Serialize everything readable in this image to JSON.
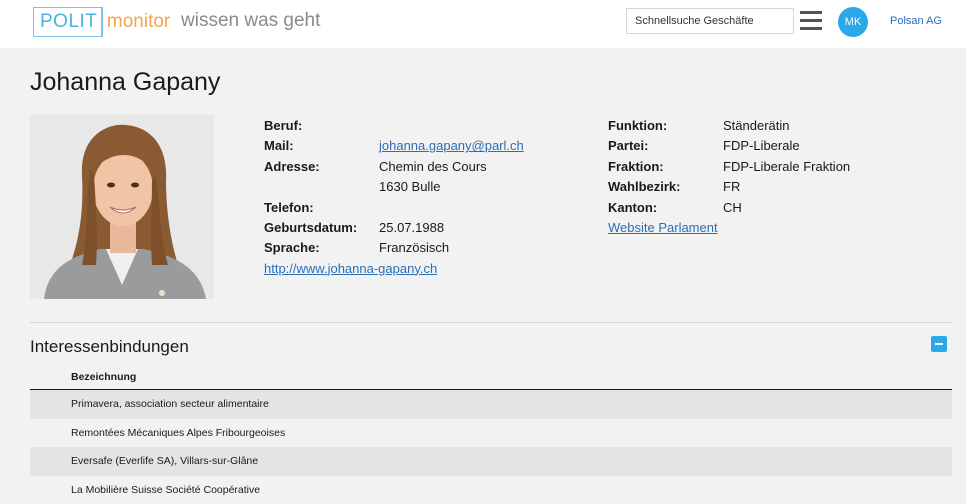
{
  "header": {
    "logo_left": "POLIT",
    "logo_right": "monitor",
    "tagline": "wissen was geht",
    "search_placeholder": "Schnellsuche Geschäfte",
    "avatar_initials": "MK",
    "company": "Polsan AG"
  },
  "profile": {
    "name": "Johanna Gapany",
    "left": [
      {
        "label": "Beruf:",
        "value": "",
        "link": false
      },
      {
        "label": "Mail:",
        "value": "johanna.gapany@parl.ch",
        "link": true
      },
      {
        "label": "Adresse:",
        "value": "Chemin des Cours",
        "link": false
      },
      {
        "label": "",
        "value": "1630 Bulle",
        "link": false
      },
      {
        "label": "Telefon:",
        "value": "",
        "link": false
      },
      {
        "label": "Geburtsdatum:",
        "value": "25.07.1988",
        "link": false
      },
      {
        "label": "Sprache:",
        "value": "Französisch",
        "link": false
      }
    ],
    "website": "http://www.johanna-gapany.ch",
    "right": [
      {
        "label": "Funktion:",
        "value": "Ständerätin"
      },
      {
        "label": "Partei:",
        "value": "FDP-Liberale"
      },
      {
        "label": "Fraktion:",
        "value": "FDP-Liberale Fraktion"
      },
      {
        "label": "Wahlbezirk:",
        "value": "FR"
      },
      {
        "label": "Kanton:",
        "value": "CH"
      }
    ],
    "parliament_link": "Website Parlament"
  },
  "interests": {
    "title": "Interessenbindungen",
    "column_header": "Bezeichnung",
    "rows": [
      "Primavera, association secteur alimentaire",
      "Remontées Mécaniques Alpes Fribourgeoises",
      "Eversafe (Everlife SA), Villars-sur-Glâne",
      "La Mobilière Suisse Société Coopérative"
    ]
  },
  "colors": {
    "accent": "#2aa8e8",
    "link": "#2a6fb8",
    "logo_orange": "#f2a54a"
  }
}
